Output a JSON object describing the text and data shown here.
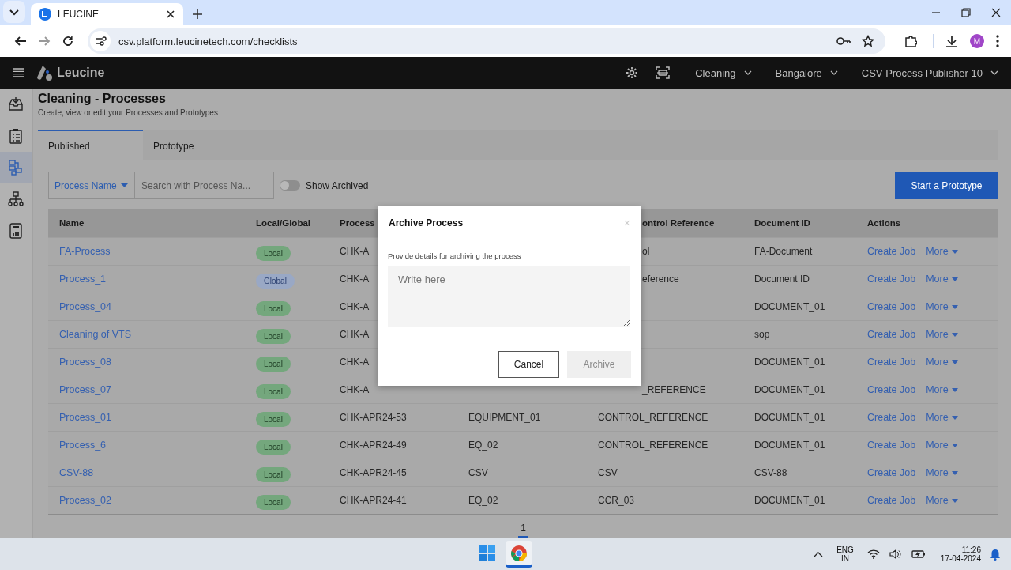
{
  "browser": {
    "tab_title": "LEUCINE",
    "url": "csv.platform.leucinetech.com/checklists",
    "profile_initial": "M"
  },
  "app_header": {
    "brand": "Leucine",
    "menus": [
      {
        "label": "Cleaning"
      },
      {
        "label": "Bangalore"
      },
      {
        "label": "CSV Process Publisher 10"
      }
    ]
  },
  "sidebar": {
    "items": [
      {
        "kind": "inbox",
        "selected": false
      },
      {
        "kind": "checklist",
        "selected": false
      },
      {
        "kind": "flow",
        "selected": true
      },
      {
        "kind": "hierarchy",
        "selected": false
      },
      {
        "kind": "report",
        "selected": false
      }
    ]
  },
  "page": {
    "title": "Cleaning - Processes",
    "subtitle": "Create, view or edit your Processes and Prototypes"
  },
  "tabs": [
    {
      "label": "Published",
      "selected": true
    },
    {
      "label": "Prototype",
      "selected": false
    }
  ],
  "filters": {
    "field_select": "Process Name",
    "search": {
      "placeholder": "Search with Process Na..."
    },
    "toggle": {
      "label": "Show Archived",
      "on": false
    },
    "action_button": "Start a Prototype"
  },
  "table": {
    "columns": [
      {
        "label": "Name"
      },
      {
        "label": "Local/Global"
      },
      {
        "label": "Process"
      },
      {},
      {
        "label": "ontrol Reference"
      },
      {
        "label": "Document ID"
      },
      {
        "label": "Actions"
      }
    ],
    "rows": [
      {
        "name": "FA-Process",
        "scope": {
          "label": "Local",
          "kind": "local"
        },
        "column_3": "CHK-A",
        "column_5": "ol",
        "document_id": "FA-Document",
        "actions": [
          "Create Job",
          "More"
        ]
      },
      {
        "name": "Process_1",
        "scope": {
          "label": "Global",
          "kind": "global"
        },
        "column_3": "CHK-A",
        "column_5": "eference",
        "document_id": "Document ID",
        "actions": [
          "Create Job",
          "More"
        ]
      },
      {
        "name": "Process_04",
        "scope": {
          "label": "Local",
          "kind": "local"
        },
        "column_3": "CHK-A",
        "document_id": "DOCUMENT_01",
        "actions": [
          "Create Job",
          "More"
        ]
      },
      {
        "name": "Cleaning of VTS",
        "scope": {
          "label": "Local",
          "kind": "local"
        },
        "column_3": "CHK-A",
        "document_id": "sop",
        "actions": [
          "Create Job",
          "More"
        ]
      },
      {
        "name": "Process_08",
        "scope": {
          "label": "Local",
          "kind": "local"
        },
        "column_3": "CHK-A",
        "document_id": "DOCUMENT_01",
        "actions": [
          "Create Job",
          "More"
        ]
      },
      {
        "name": "Process_07",
        "scope": {
          "label": "Local",
          "kind": "local"
        },
        "column_3": "CHK-A",
        "column_5": "_REFERENCE",
        "document_id": "DOCUMENT_01",
        "actions": [
          "Create Job",
          "More"
        ]
      },
      {
        "name": "Process_01",
        "scope": {
          "label": "Local",
          "kind": "local"
        },
        "column_3": "CHK-APR24-53",
        "column_4": "EQUIPMENT_01",
        "column_5": "CONTROL_REFERENCE",
        "document_id": "DOCUMENT_01",
        "actions": [
          "Create Job",
          "More"
        ]
      },
      {
        "name": "Process_6",
        "scope": {
          "label": "Local",
          "kind": "local"
        },
        "column_3": "CHK-APR24-49",
        "column_4": "EQ_02",
        "column_5": "CONTROL_REFERENCE",
        "document_id": "DOCUMENT_01",
        "actions": [
          "Create Job",
          "More"
        ]
      },
      {
        "name": "CSV-88",
        "scope": {
          "label": "Local",
          "kind": "local"
        },
        "column_3": "CHK-APR24-45",
        "column_4": "CSV",
        "column_5": "CSV",
        "document_id": "CSV-88",
        "actions": [
          "Create Job",
          "More"
        ]
      },
      {
        "name": "Process_02",
        "scope": {
          "label": "Local",
          "kind": "local"
        },
        "column_3": "CHK-APR24-41",
        "column_4": "EQ_02",
        "column_5": "CCR_03",
        "document_id": "DOCUMENT_01",
        "actions": [
          "Create Job",
          "More"
        ]
      }
    ]
  },
  "pagination": [
    {
      "label": "1",
      "selected": true
    }
  ],
  "modal": {
    "title": "Archive Process",
    "close": "×",
    "label": "Provide details for archiving the process",
    "placeholder": "Write here",
    "buttons": [
      {
        "label": "Cancel",
        "disabled": false
      },
      {
        "label": "Archive",
        "disabled": true
      }
    ]
  },
  "taskbar": {
    "apps": [
      {
        "kind": "windows",
        "active": false
      },
      {
        "kind": "chrome",
        "active": true
      }
    ],
    "language": "ENG",
    "region": "IN",
    "time": "11:26",
    "date": "17-04-2024"
  }
}
